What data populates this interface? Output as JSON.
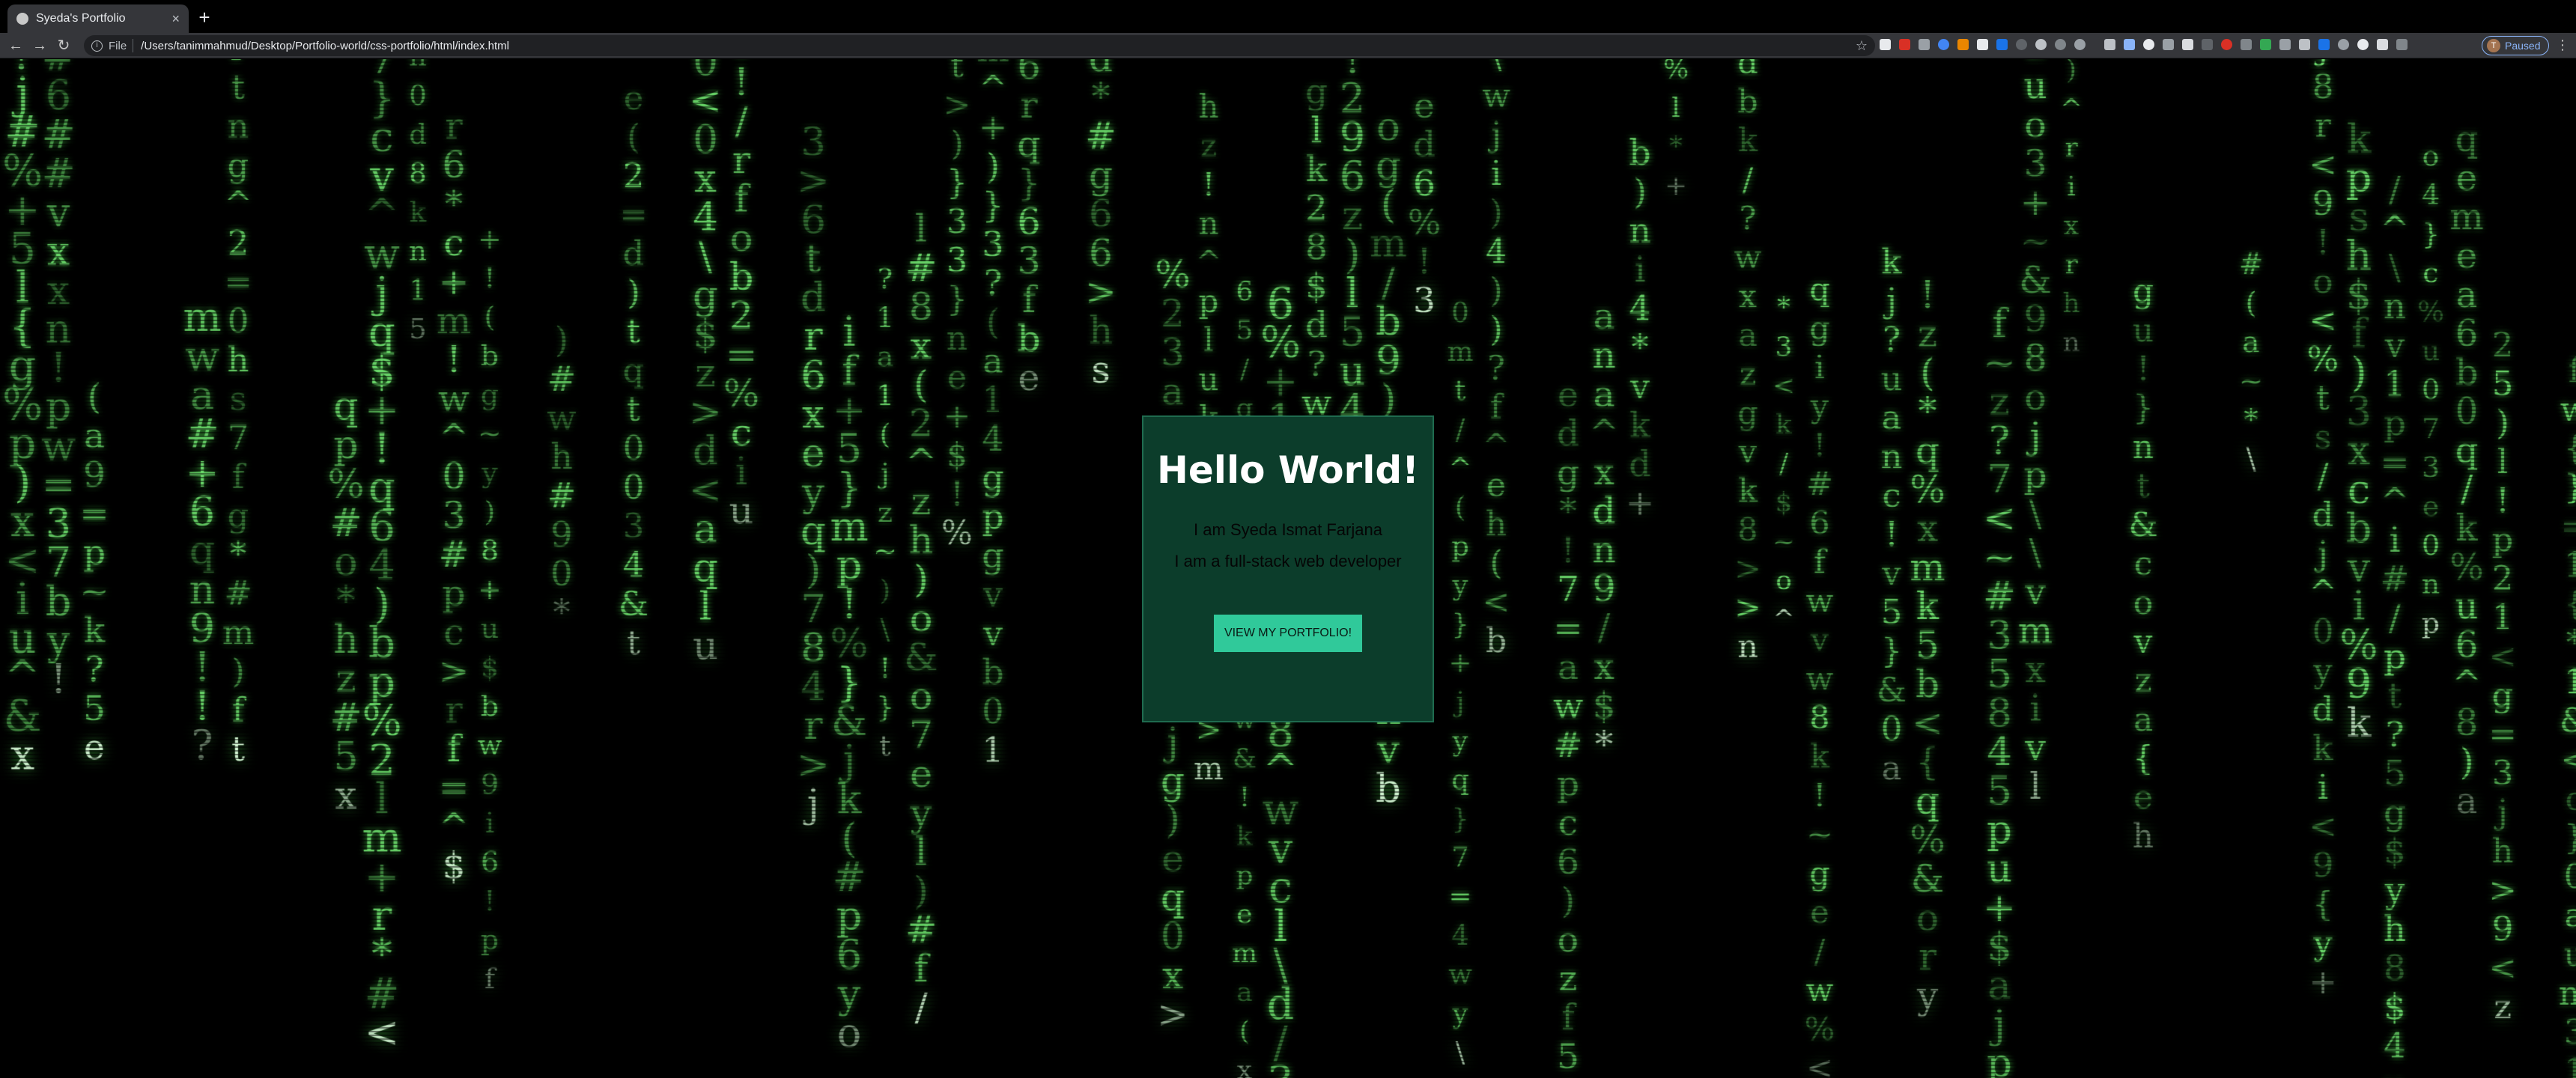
{
  "browser": {
    "tab_title": "Syeda's Portfolio",
    "tab_close": "×",
    "new_tab": "+",
    "back": "←",
    "forward": "→",
    "reload": "↻",
    "scheme": "File",
    "url": "/Users/tanimmahmud/Desktop/Portfolio-world/css-portfolio/html/index.html",
    "profile_initial": "T",
    "profile_status": "Paused",
    "menu": "⋮",
    "star": "☆"
  },
  "hero": {
    "title": "Hello World!",
    "line1": "I am Syeda Ismat Farjana",
    "line2": "I am a full-stack web developer",
    "button": "VIEW MY PORTFOLIO!"
  },
  "colors": {
    "rain": "#6bd96b",
    "card_bg": "#0c3d2b",
    "button_bg": "#30c99a"
  }
}
